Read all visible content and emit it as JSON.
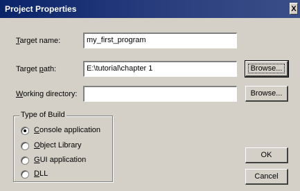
{
  "window": {
    "title": "Project Properties",
    "close_label": "X"
  },
  "fields": {
    "target_name": {
      "label_first": "T",
      "label_rest": "arget name:",
      "value": "my_first_program"
    },
    "target_path": {
      "label_pre": "Target ",
      "label_ul": "p",
      "label_post": "ath:",
      "value": "E:\\tutorial\\chapter 1"
    },
    "working_dir": {
      "label_first": "W",
      "label_rest": "orking directory:",
      "value": ""
    }
  },
  "buttons": {
    "browse_path": "Browse...",
    "browse_dir": "Browse...",
    "ok": "OK",
    "cancel": "Cancel"
  },
  "build_group": {
    "title": "Type of Build",
    "options": [
      {
        "ul": "C",
        "rest": "onsole application",
        "selected": true
      },
      {
        "ul": "O",
        "rest": "bject Library",
        "selected": false
      },
      {
        "ul": "G",
        "rest": "UI application",
        "selected": false
      },
      {
        "ul": "D",
        "rest": "LL",
        "selected": false
      }
    ]
  }
}
